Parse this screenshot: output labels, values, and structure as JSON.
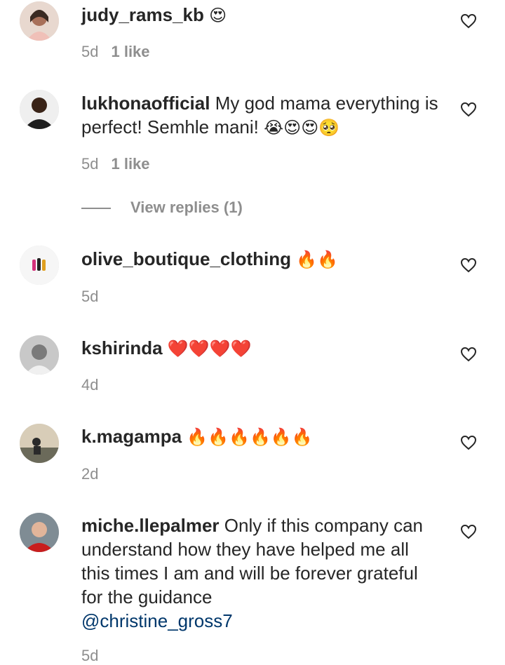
{
  "comments": [
    {
      "username": "judy_rams_kb",
      "text": "",
      "emoji": "😍",
      "time": "5d",
      "likes": "1 like"
    },
    {
      "username": "lukhonaofficial",
      "text": "My god mama everything is perfect! Semhle mani!",
      "emoji": "😭😍😍🥺",
      "time": "5d",
      "likes": "1 like"
    },
    {
      "username": "olive_boutique_clothing",
      "text": "",
      "emoji": "🔥🔥",
      "time": "5d",
      "likes": ""
    },
    {
      "username": "kshirinda",
      "text": "",
      "emoji": "❤️❤️❤️❤️",
      "time": "4d",
      "likes": ""
    },
    {
      "username": "k.magampa",
      "text": "",
      "emoji": "🔥🔥🔥🔥🔥🔥",
      "time": "2d",
      "likes": ""
    },
    {
      "username": "miche.llepalmer",
      "text": "Only if this company can understand how they have helped me all this times I am and will be forever grateful for the guidance",
      "mention": "@christine_gross7",
      "time": "5d",
      "likes": ""
    }
  ],
  "view_replies": "View replies (1)",
  "icons": {
    "like": "heart-outline-icon"
  },
  "colors": {
    "text": "#262626",
    "secondary": "#8e8e8e",
    "mention": "#00376b"
  }
}
